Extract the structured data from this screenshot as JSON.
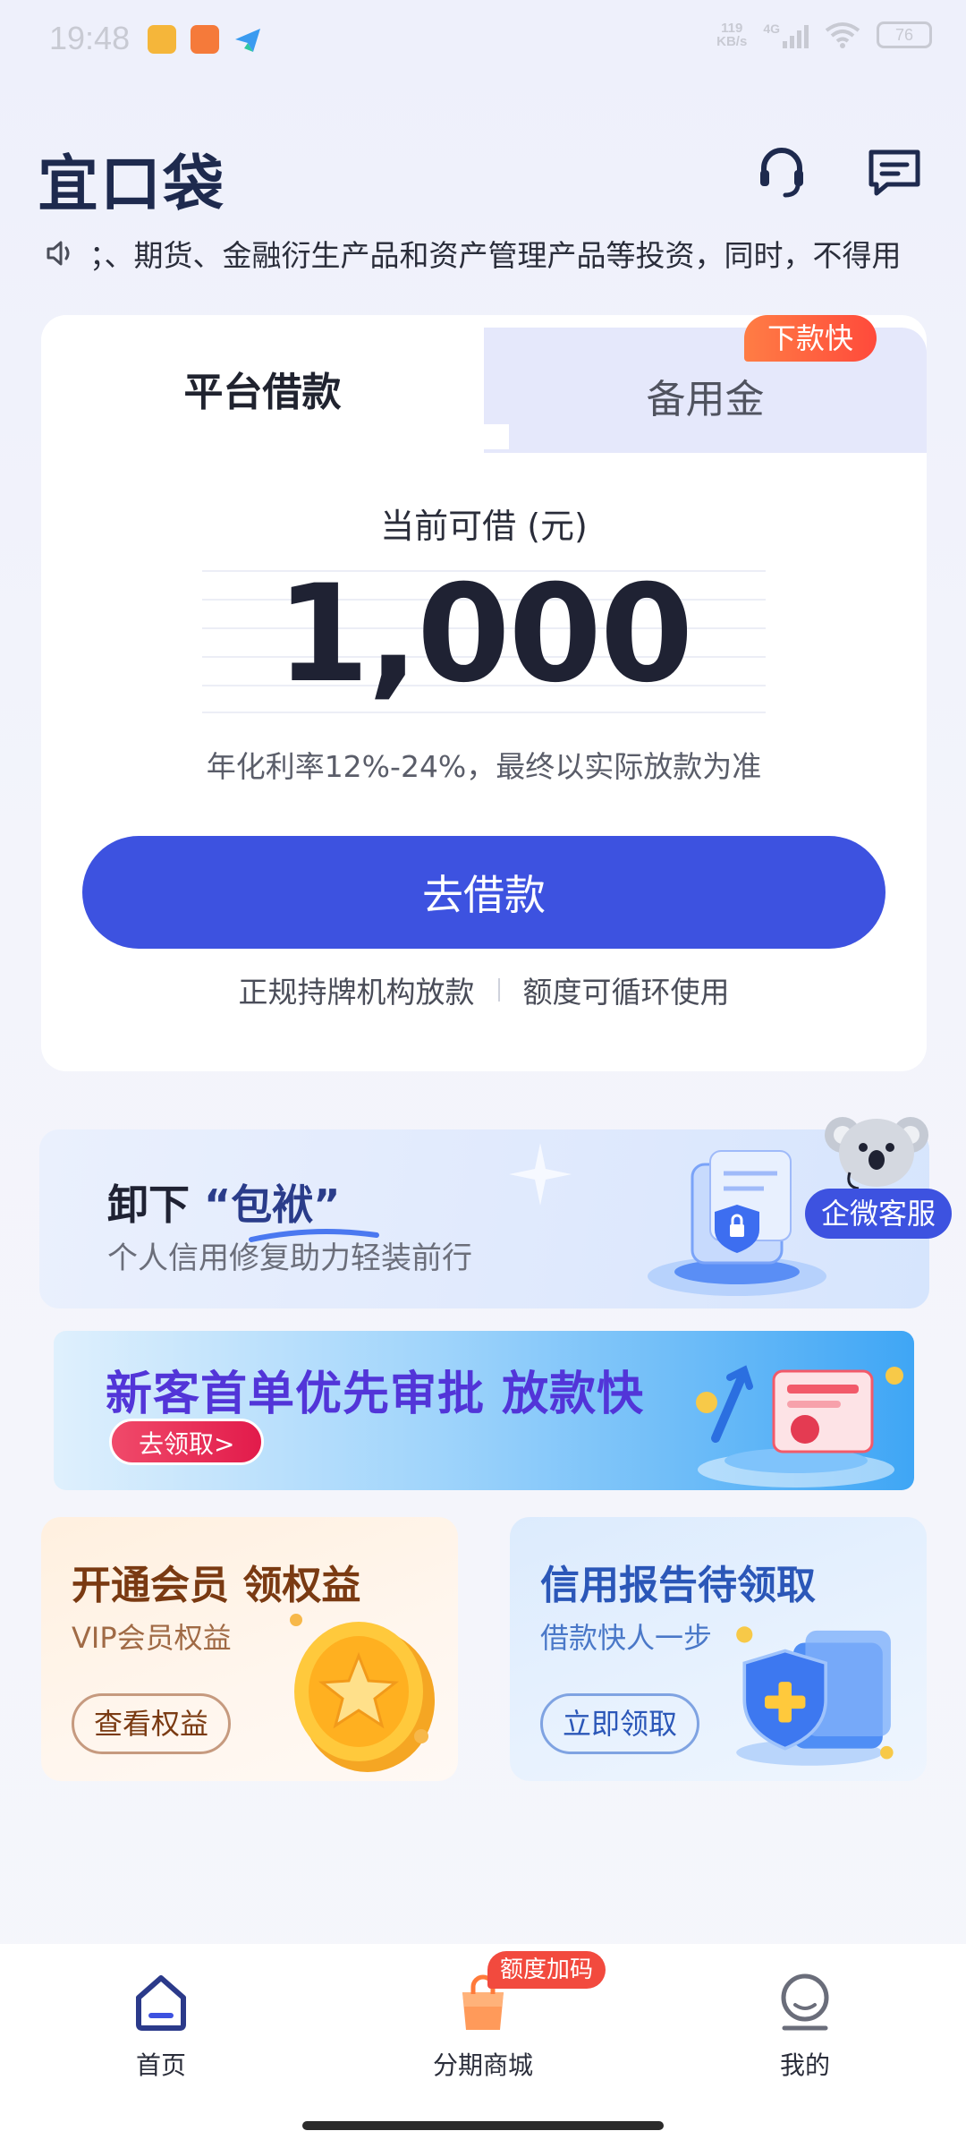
{
  "status_bar": {
    "time": "19:48",
    "net_speed": "119",
    "net_unit": "KB/s",
    "network": "4G",
    "battery": "76"
  },
  "header": {
    "logo_text": "宜口袋",
    "icons": [
      "headset-icon",
      "message-icon"
    ]
  },
  "notice": {
    "icon": "speaker-icon",
    "text": "；、期货、金融衍生产品和资产管理产品等投资，同时，不得用"
  },
  "loan_card": {
    "tab_left": "平台借款",
    "tab_right": "备用金",
    "tab_right_badge": "下款快",
    "amount_label": "当前可借 (元)",
    "amount": "1,000",
    "rate_note": "年化利率12%-24%，最终以实际放款为准",
    "button": "去借款",
    "feature_1": "正规持牌机构放款",
    "feature_2": "额度可循环使用"
  },
  "banner_repair": {
    "title_prefix": "卸下",
    "title_highlight": "“包袱”",
    "subtitle": "个人信用修复助力轻装前行"
  },
  "wechat_service": {
    "label": "企微客服"
  },
  "banner_newuser": {
    "title": "新客首单优先审批 放款快",
    "button": "去领取>"
  },
  "card_vip": {
    "title": "开通会员 领权益",
    "subtitle": "VIP会员权益",
    "button": "查看权益"
  },
  "card_credit": {
    "title": "信用报告待领取",
    "subtitle": "借款快人一步",
    "button": "立即领取"
  },
  "bottom_nav": {
    "items": [
      {
        "label": "首页",
        "icon": "home-icon"
      },
      {
        "label": "分期商城",
        "icon": "shopping-bag-icon"
      },
      {
        "label": "我的",
        "icon": "profile-icon"
      }
    ],
    "promo_badge": "额度加码"
  },
  "colors": {
    "primary": "#3d52e0",
    "badge_orange": "#ff5a3c",
    "promo_red": "#f24a3e"
  }
}
